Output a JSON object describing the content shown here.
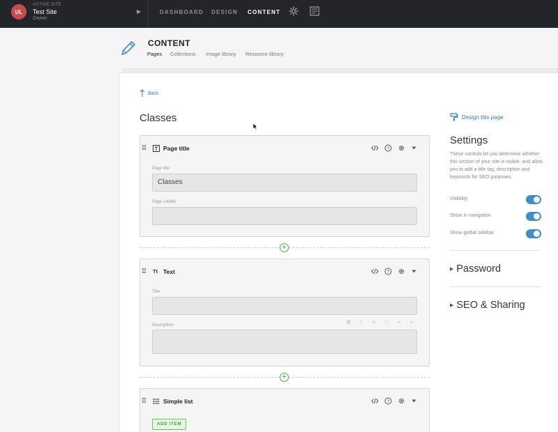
{
  "topbar": {
    "avatar_initials": "UL",
    "active_site_label": "ACTIVE SITE",
    "site_name": "Test Site",
    "site_role": "Owner",
    "nav": {
      "dashboard": "DASHBOARD",
      "design": "DESIGN",
      "content": "CONTENT"
    }
  },
  "content_header": {
    "title": "CONTENT",
    "tabs": [
      "Pages",
      "Collections",
      "Image library",
      "Resource library"
    ]
  },
  "main": {
    "back_label": "Back",
    "page_heading": "Classes",
    "sections": {
      "page_title": {
        "title": "Page title",
        "field1_label": "Page title",
        "field1_value": "Classes",
        "field2_label": "Page subtitle",
        "field2_value": ""
      },
      "text": {
        "title": "Text",
        "icon_text": "Tt",
        "field1_label": "Title",
        "field2_label": "Description"
      },
      "simple_list": {
        "title": "Simple list",
        "add_label": "ADD ITEM"
      }
    }
  },
  "sidebar": {
    "design_link": "Design this page",
    "settings_title": "Settings",
    "settings_desc": "These controls let you determine whether this section of your site is visible, and allow you to add a title tag, description and keywords for SEO purposes.",
    "toggles": [
      {
        "label": "Visibility",
        "on": true
      },
      {
        "label": "Show in navigation",
        "on": true
      },
      {
        "label": "Show global sidebar",
        "on": true
      }
    ],
    "password_label": "Password",
    "seo_label": "SEO & Sharing"
  },
  "colors": {
    "topbar": "#232529",
    "accent_blue": "#2f7bbf",
    "toggle_on": "#3f8fc4",
    "add_green": "#3cb34a",
    "avatar": "#c94b4b"
  }
}
